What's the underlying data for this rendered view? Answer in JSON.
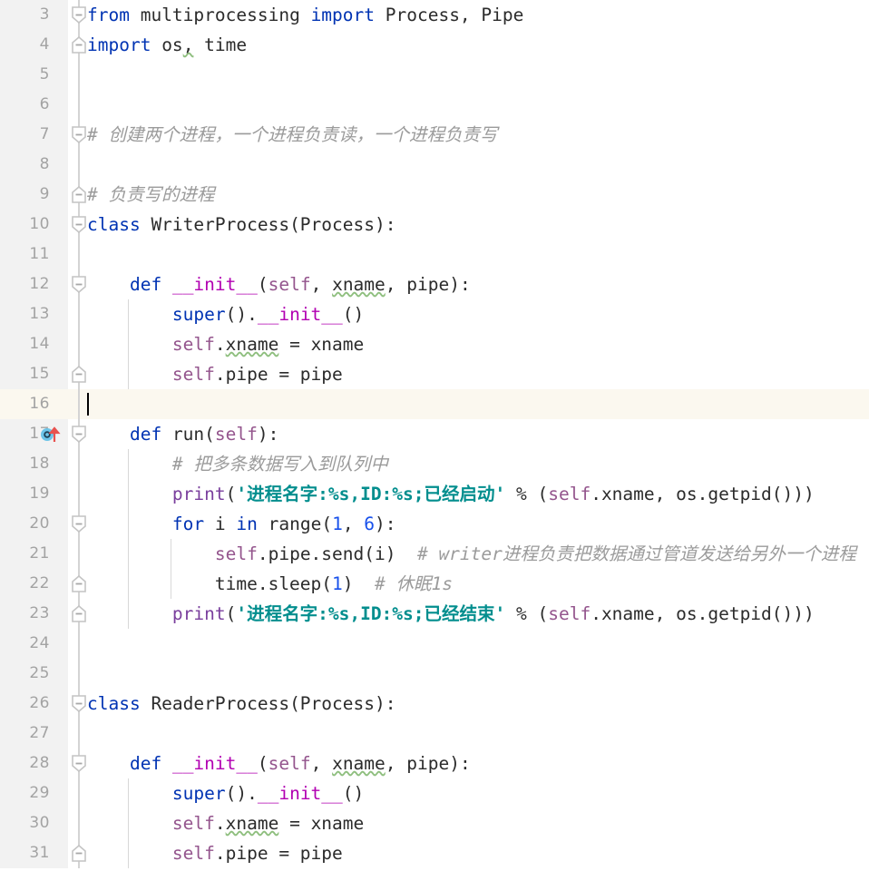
{
  "editor": {
    "language": "python",
    "theme": "light",
    "line_height_px": 33,
    "first_visible_line": 3,
    "caret_line": 16,
    "caret_column": 1,
    "colors": {
      "background": "#ffffff",
      "gutter_background": "#f2f2f2",
      "current_line_background": "#fbf8ef",
      "line_number": "#a3a3a3",
      "keyword": "#0033b3",
      "string": "#038e8e",
      "comment": "#9b9b9b",
      "self": "#94558d",
      "dunder": "#b200b2",
      "number": "#1750eb",
      "function": "#7a3f9d",
      "text": "#2b2b2b",
      "typo_underline": "#8fbf7f",
      "fold_guide": "#d4d4d4",
      "indent_guide": "#d8d8d8",
      "run_marker_circle": "#6cc4e8",
      "run_marker_arrow": "#e8524f"
    }
  },
  "gutter": {
    "run_marker_line": 17,
    "run_marker_name": "run-test-marker"
  },
  "lines": [
    {
      "n": 3,
      "fold": "start",
      "indent_guides": [],
      "text": "from multiprocessing import Process, Pipe",
      "tokens": [
        {
          "t": "from",
          "c": "kw"
        },
        {
          "t": " multiprocessing ",
          "c": "plain"
        },
        {
          "t": "import",
          "c": "kw"
        },
        {
          "t": " Process, Pipe",
          "c": "plain"
        }
      ]
    },
    {
      "n": 4,
      "fold": "end",
      "indent_guides": [],
      "text": "import os, time",
      "tokens": [
        {
          "t": "import",
          "c": "kw"
        },
        {
          "t": " os",
          "c": "plain"
        },
        {
          "t": ",",
          "c": "typo"
        },
        {
          "t": " time",
          "c": "plain"
        }
      ]
    },
    {
      "n": 5,
      "fold": "",
      "indent_guides": [],
      "text": "",
      "tokens": []
    },
    {
      "n": 6,
      "fold": "",
      "indent_guides": [],
      "text": "",
      "tokens": []
    },
    {
      "n": 7,
      "fold": "start",
      "indent_guides": [],
      "text": "# 创建两个进程，一个进程负责读，一个进程负责写",
      "tokens": [
        {
          "t": "# 创建两个进程，一个进程负责读，一个进程负责写",
          "c": "com"
        }
      ]
    },
    {
      "n": 8,
      "fold": "",
      "indent_guides": [],
      "text": "",
      "tokens": []
    },
    {
      "n": 9,
      "fold": "end",
      "indent_guides": [],
      "text": "# 负责写的进程",
      "tokens": [
        {
          "t": "# 负责写的进程",
          "c": "com"
        }
      ]
    },
    {
      "n": 10,
      "fold": "start",
      "indent_guides": [],
      "text": "class WriterProcess(Process):",
      "tokens": [
        {
          "t": "class",
          "c": "kw"
        },
        {
          "t": " WriterProcess(Process):",
          "c": "plain"
        }
      ]
    },
    {
      "n": 11,
      "fold": "",
      "indent_guides": [],
      "text": "",
      "tokens": []
    },
    {
      "n": 12,
      "fold": "start",
      "indent_guides": [],
      "text": "    def __init__(self, xname, pipe):",
      "tokens": [
        {
          "t": "    ",
          "c": "plain"
        },
        {
          "t": "def",
          "c": "kw"
        },
        {
          "t": " ",
          "c": "plain"
        },
        {
          "t": "__init__",
          "c": "dunder"
        },
        {
          "t": "(",
          "c": "plain"
        },
        {
          "t": "self",
          "c": "self"
        },
        {
          "t": ", ",
          "c": "plain"
        },
        {
          "t": "xname",
          "c": "typo"
        },
        {
          "t": ", pipe):",
          "c": "plain"
        }
      ]
    },
    {
      "n": 13,
      "fold": "",
      "indent_guides": [
        1
      ],
      "text": "        super().__init__()",
      "tokens": [
        {
          "t": "        ",
          "c": "plain"
        },
        {
          "t": "super",
          "c": "kw"
        },
        {
          "t": "().",
          "c": "plain"
        },
        {
          "t": "__init__",
          "c": "dunder"
        },
        {
          "t": "()",
          "c": "plain"
        }
      ]
    },
    {
      "n": 14,
      "fold": "",
      "indent_guides": [
        1
      ],
      "text": "        self.xname = xname",
      "tokens": [
        {
          "t": "        ",
          "c": "plain"
        },
        {
          "t": "self",
          "c": "self"
        },
        {
          "t": ".",
          "c": "plain"
        },
        {
          "t": "xname",
          "c": "typo"
        },
        {
          "t": " = xname",
          "c": "plain"
        }
      ]
    },
    {
      "n": 15,
      "fold": "end",
      "indent_guides": [
        1
      ],
      "text": "        self.pipe = pipe",
      "tokens": [
        {
          "t": "        ",
          "c": "plain"
        },
        {
          "t": "self",
          "c": "self"
        },
        {
          "t": ".pipe = pipe",
          "c": "plain"
        }
      ]
    },
    {
      "n": 16,
      "fold": "",
      "current": true,
      "caret": true,
      "indent_guides": [],
      "text": "",
      "tokens": []
    },
    {
      "n": 17,
      "fold": "start",
      "marker": "run",
      "indent_guides": [],
      "text": "    def run(self):",
      "tokens": [
        {
          "t": "    ",
          "c": "plain"
        },
        {
          "t": "def",
          "c": "kw"
        },
        {
          "t": " run(",
          "c": "plain"
        },
        {
          "t": "self",
          "c": "self"
        },
        {
          "t": "):",
          "c": "plain"
        }
      ]
    },
    {
      "n": 18,
      "fold": "",
      "indent_guides": [
        1
      ],
      "text": "        # 把多条数据写入到队列中",
      "tokens": [
        {
          "t": "        ",
          "c": "plain"
        },
        {
          "t": "# 把多条数据写入到队列中",
          "c": "com"
        }
      ]
    },
    {
      "n": 19,
      "fold": "",
      "indent_guides": [
        1
      ],
      "text": "        print('进程名字:%s,ID:%s;已经启动' % (self.xname, os.getpid()))",
      "tokens": [
        {
          "t": "        ",
          "c": "plain"
        },
        {
          "t": "print",
          "c": "fn"
        },
        {
          "t": "(",
          "c": "plain"
        },
        {
          "t": "'进程名字:%s,ID:%s;已经启动'",
          "c": "str"
        },
        {
          "t": " % (",
          "c": "plain"
        },
        {
          "t": "self",
          "c": "self"
        },
        {
          "t": ".xname, os.getpid()))",
          "c": "plain"
        }
      ]
    },
    {
      "n": 20,
      "fold": "start",
      "indent_guides": [
        1
      ],
      "text": "        for i in range(1, 6):",
      "tokens": [
        {
          "t": "        ",
          "c": "plain"
        },
        {
          "t": "for",
          "c": "kw"
        },
        {
          "t": " i ",
          "c": "plain"
        },
        {
          "t": "in",
          "c": "kw"
        },
        {
          "t": " range(",
          "c": "plain"
        },
        {
          "t": "1",
          "c": "num"
        },
        {
          "t": ", ",
          "c": "plain"
        },
        {
          "t": "6",
          "c": "num"
        },
        {
          "t": "):",
          "c": "plain"
        }
      ]
    },
    {
      "n": 21,
      "fold": "",
      "indent_guides": [
        1,
        2
      ],
      "text": "            self.pipe.send(i)  # writer进程负责把数据通过管道发送给另外一个进程",
      "tokens": [
        {
          "t": "            ",
          "c": "plain"
        },
        {
          "t": "self",
          "c": "self"
        },
        {
          "t": ".pipe.send(i)",
          "c": "plain"
        },
        {
          "t": "  # writer进程负责把数据通过管道发送给另外一个进程",
          "c": "com"
        }
      ]
    },
    {
      "n": 22,
      "fold": "end",
      "indent_guides": [
        1,
        2
      ],
      "text": "            time.sleep(1)  # 休眠1s",
      "tokens": [
        {
          "t": "            time.sleep(",
          "c": "plain"
        },
        {
          "t": "1",
          "c": "num"
        },
        {
          "t": ")",
          "c": "plain"
        },
        {
          "t": "  # 休眠1s",
          "c": "com"
        }
      ]
    },
    {
      "n": 23,
      "fold": "end",
      "indent_guides": [
        1
      ],
      "text": "        print('进程名字:%s,ID:%s;已经结束' % (self.xname, os.getpid()))",
      "tokens": [
        {
          "t": "        ",
          "c": "plain"
        },
        {
          "t": "print",
          "c": "fn"
        },
        {
          "t": "(",
          "c": "plain"
        },
        {
          "t": "'进程名字:%s,ID:%s;已经结束'",
          "c": "str"
        },
        {
          "t": " % (",
          "c": "plain"
        },
        {
          "t": "self",
          "c": "self"
        },
        {
          "t": ".xname, os.getpid()))",
          "c": "plain"
        }
      ]
    },
    {
      "n": 24,
      "fold": "",
      "indent_guides": [],
      "text": "",
      "tokens": []
    },
    {
      "n": 25,
      "fold": "",
      "indent_guides": [],
      "text": "",
      "tokens": []
    },
    {
      "n": 26,
      "fold": "start",
      "indent_guides": [],
      "text": "class ReaderProcess(Process):",
      "tokens": [
        {
          "t": "class",
          "c": "kw"
        },
        {
          "t": " ReaderProcess(Process):",
          "c": "plain"
        }
      ]
    },
    {
      "n": 27,
      "fold": "",
      "indent_guides": [],
      "text": "",
      "tokens": []
    },
    {
      "n": 28,
      "fold": "start",
      "indent_guides": [],
      "text": "    def __init__(self, xname, pipe):",
      "tokens": [
        {
          "t": "    ",
          "c": "plain"
        },
        {
          "t": "def",
          "c": "kw"
        },
        {
          "t": " ",
          "c": "plain"
        },
        {
          "t": "__init__",
          "c": "dunder"
        },
        {
          "t": "(",
          "c": "plain"
        },
        {
          "t": "self",
          "c": "self"
        },
        {
          "t": ", ",
          "c": "plain"
        },
        {
          "t": "xname",
          "c": "typo"
        },
        {
          "t": ", pipe):",
          "c": "plain"
        }
      ]
    },
    {
      "n": 29,
      "fold": "",
      "indent_guides": [
        1
      ],
      "text": "        super().__init__()",
      "tokens": [
        {
          "t": "        ",
          "c": "plain"
        },
        {
          "t": "super",
          "c": "kw"
        },
        {
          "t": "().",
          "c": "plain"
        },
        {
          "t": "__init__",
          "c": "dunder"
        },
        {
          "t": "()",
          "c": "plain"
        }
      ]
    },
    {
      "n": 30,
      "fold": "",
      "indent_guides": [
        1
      ],
      "text": "        self.xname = xname",
      "tokens": [
        {
          "t": "        ",
          "c": "plain"
        },
        {
          "t": "self",
          "c": "self"
        },
        {
          "t": ".",
          "c": "plain"
        },
        {
          "t": "xname",
          "c": "typo"
        },
        {
          "t": " = xname",
          "c": "plain"
        }
      ]
    },
    {
      "n": 31,
      "fold": "end",
      "indent_guides": [
        1
      ],
      "text": "        self.pipe = pipe",
      "tokens": [
        {
          "t": "        ",
          "c": "plain"
        },
        {
          "t": "self",
          "c": "self"
        },
        {
          "t": ".pipe = pipe",
          "c": "plain"
        }
      ]
    }
  ]
}
